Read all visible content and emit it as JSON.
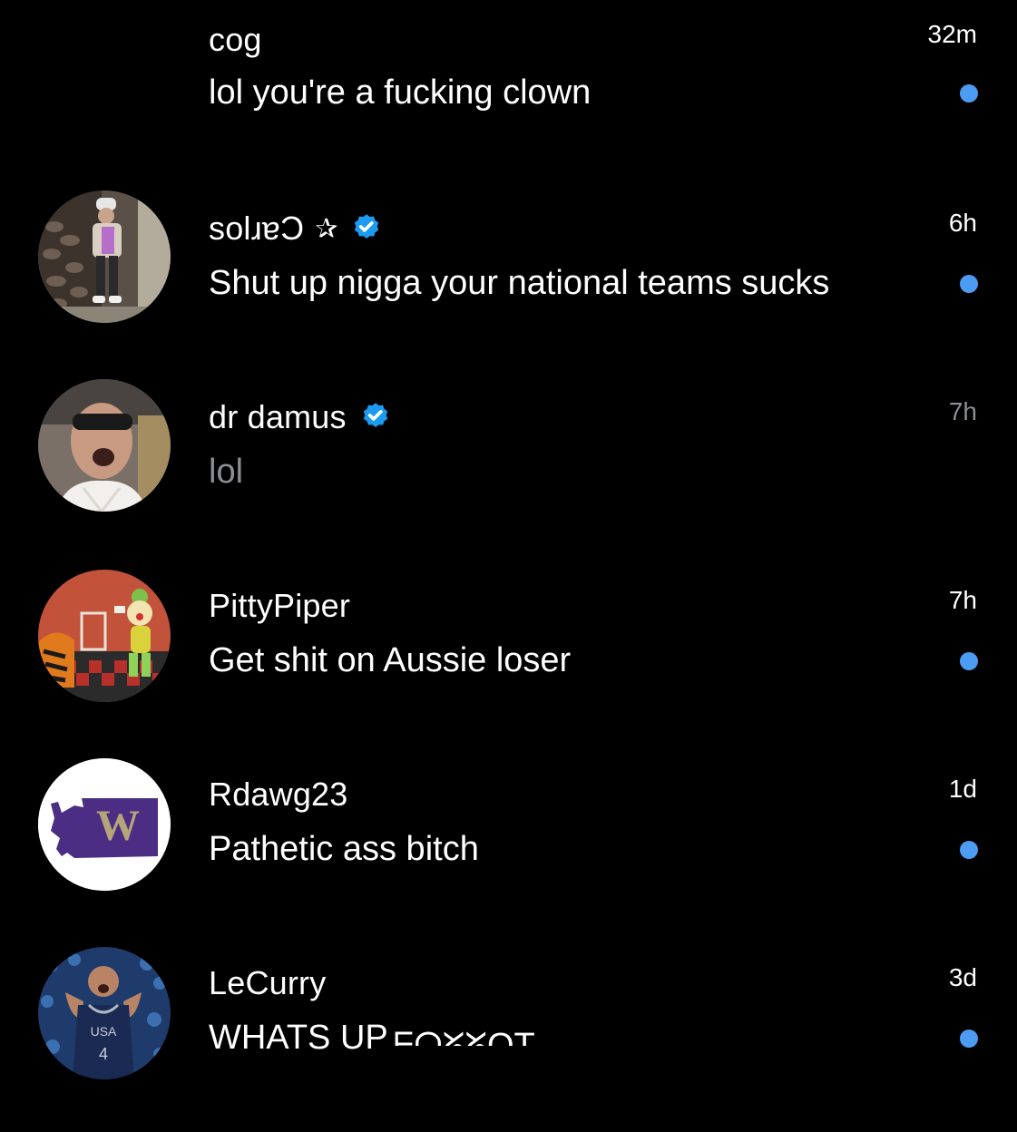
{
  "theme": {
    "background": "#000000",
    "text_primary": "#ffffff",
    "text_secondary": "#8b8f94",
    "accent_blue": "#4b9cf2",
    "verified_blue": "#1d9bf0"
  },
  "conversations": [
    {
      "name": "cog",
      "verified": false,
      "preview": "lol you're a fucking clown",
      "time": "32m",
      "unread": true
    },
    {
      "name": "solɹɐƆ",
      "name_suffix": "✰",
      "verified": true,
      "preview": "Shut up nigga your national teams sucks",
      "time": "6h",
      "unread": true,
      "avatar_icon": "person-photo-icon"
    },
    {
      "name": "dr damus",
      "verified": true,
      "preview": "lol",
      "time": "7h",
      "unread": false,
      "avatar_icon": "person-photo-icon"
    },
    {
      "name": "PittyPiper",
      "verified": false,
      "preview": "Get shit on Aussie loser",
      "time": "7h",
      "unread": true,
      "avatar_icon": "cartoon-clown-icon"
    },
    {
      "name": "Rdawg23",
      "verified": false,
      "preview": "Pathetic ass bitch",
      "time": "1d",
      "unread": true,
      "avatar_icon": "washington-w-logo-icon"
    },
    {
      "name": "LeCurry",
      "verified": false,
      "preview": "WHATS UP",
      "preview_partial_glyphs": "ᖴᗩᘜᘜOT",
      "time": "3d",
      "unread": true,
      "avatar_icon": "basketball-player-icon",
      "jersey_text": "USA",
      "jersey_number": "4"
    }
  ]
}
